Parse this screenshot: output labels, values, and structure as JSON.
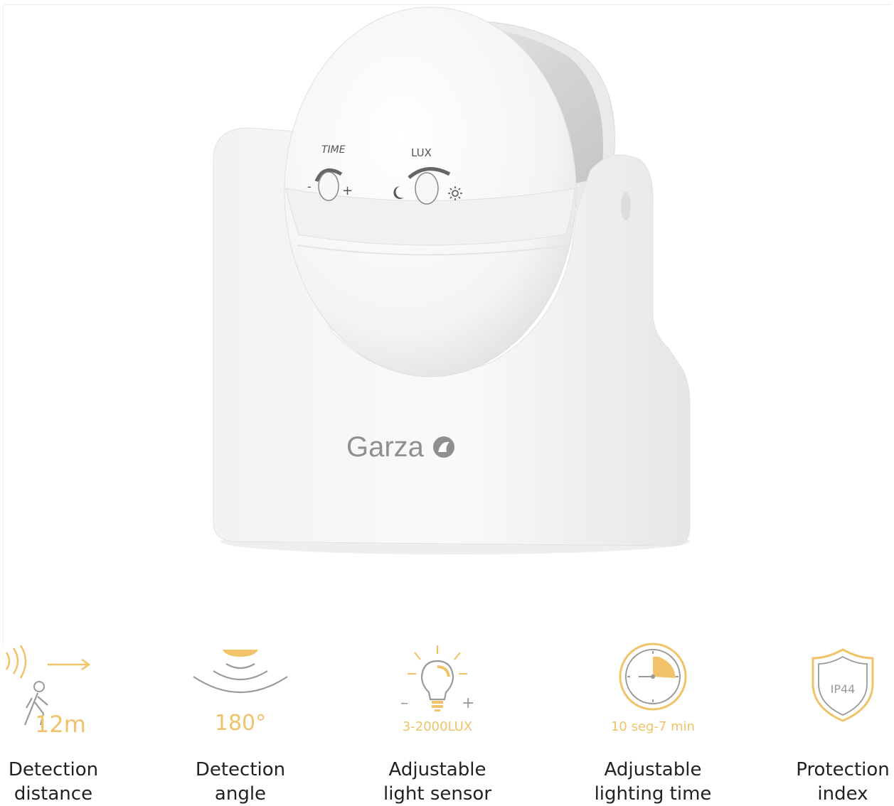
{
  "product": {
    "brand": "Garza",
    "dial_time_label": "TIME",
    "dial_lux_label": "LUX",
    "dial_minus": "-",
    "dial_plus": "+"
  },
  "features": [
    {
      "value": "12m",
      "caption_line1": "Detection",
      "caption_line2": "distance",
      "icon": "motion-person-icon"
    },
    {
      "value": "180°",
      "caption_line1": "Detection",
      "caption_line2": "angle",
      "icon": "detection-arc-icon"
    },
    {
      "value": "3-2000LUX",
      "caption_line1": "Adjustable",
      "caption_line2": "light sensor",
      "icon": "lightbulb-icon",
      "minus": "–",
      "plus": "+"
    },
    {
      "value": "10 seg-7 min",
      "caption_line1": "Adjustable",
      "caption_line2": "lighting time",
      "icon": "timer-icon"
    },
    {
      "value": "IP44",
      "caption_line1": "Protection",
      "caption_line2": "index",
      "icon": "shield-icon"
    }
  ],
  "colors": {
    "accent": "#f0c36a",
    "icon_gray": "#9a9a9a",
    "text": "#222222"
  }
}
